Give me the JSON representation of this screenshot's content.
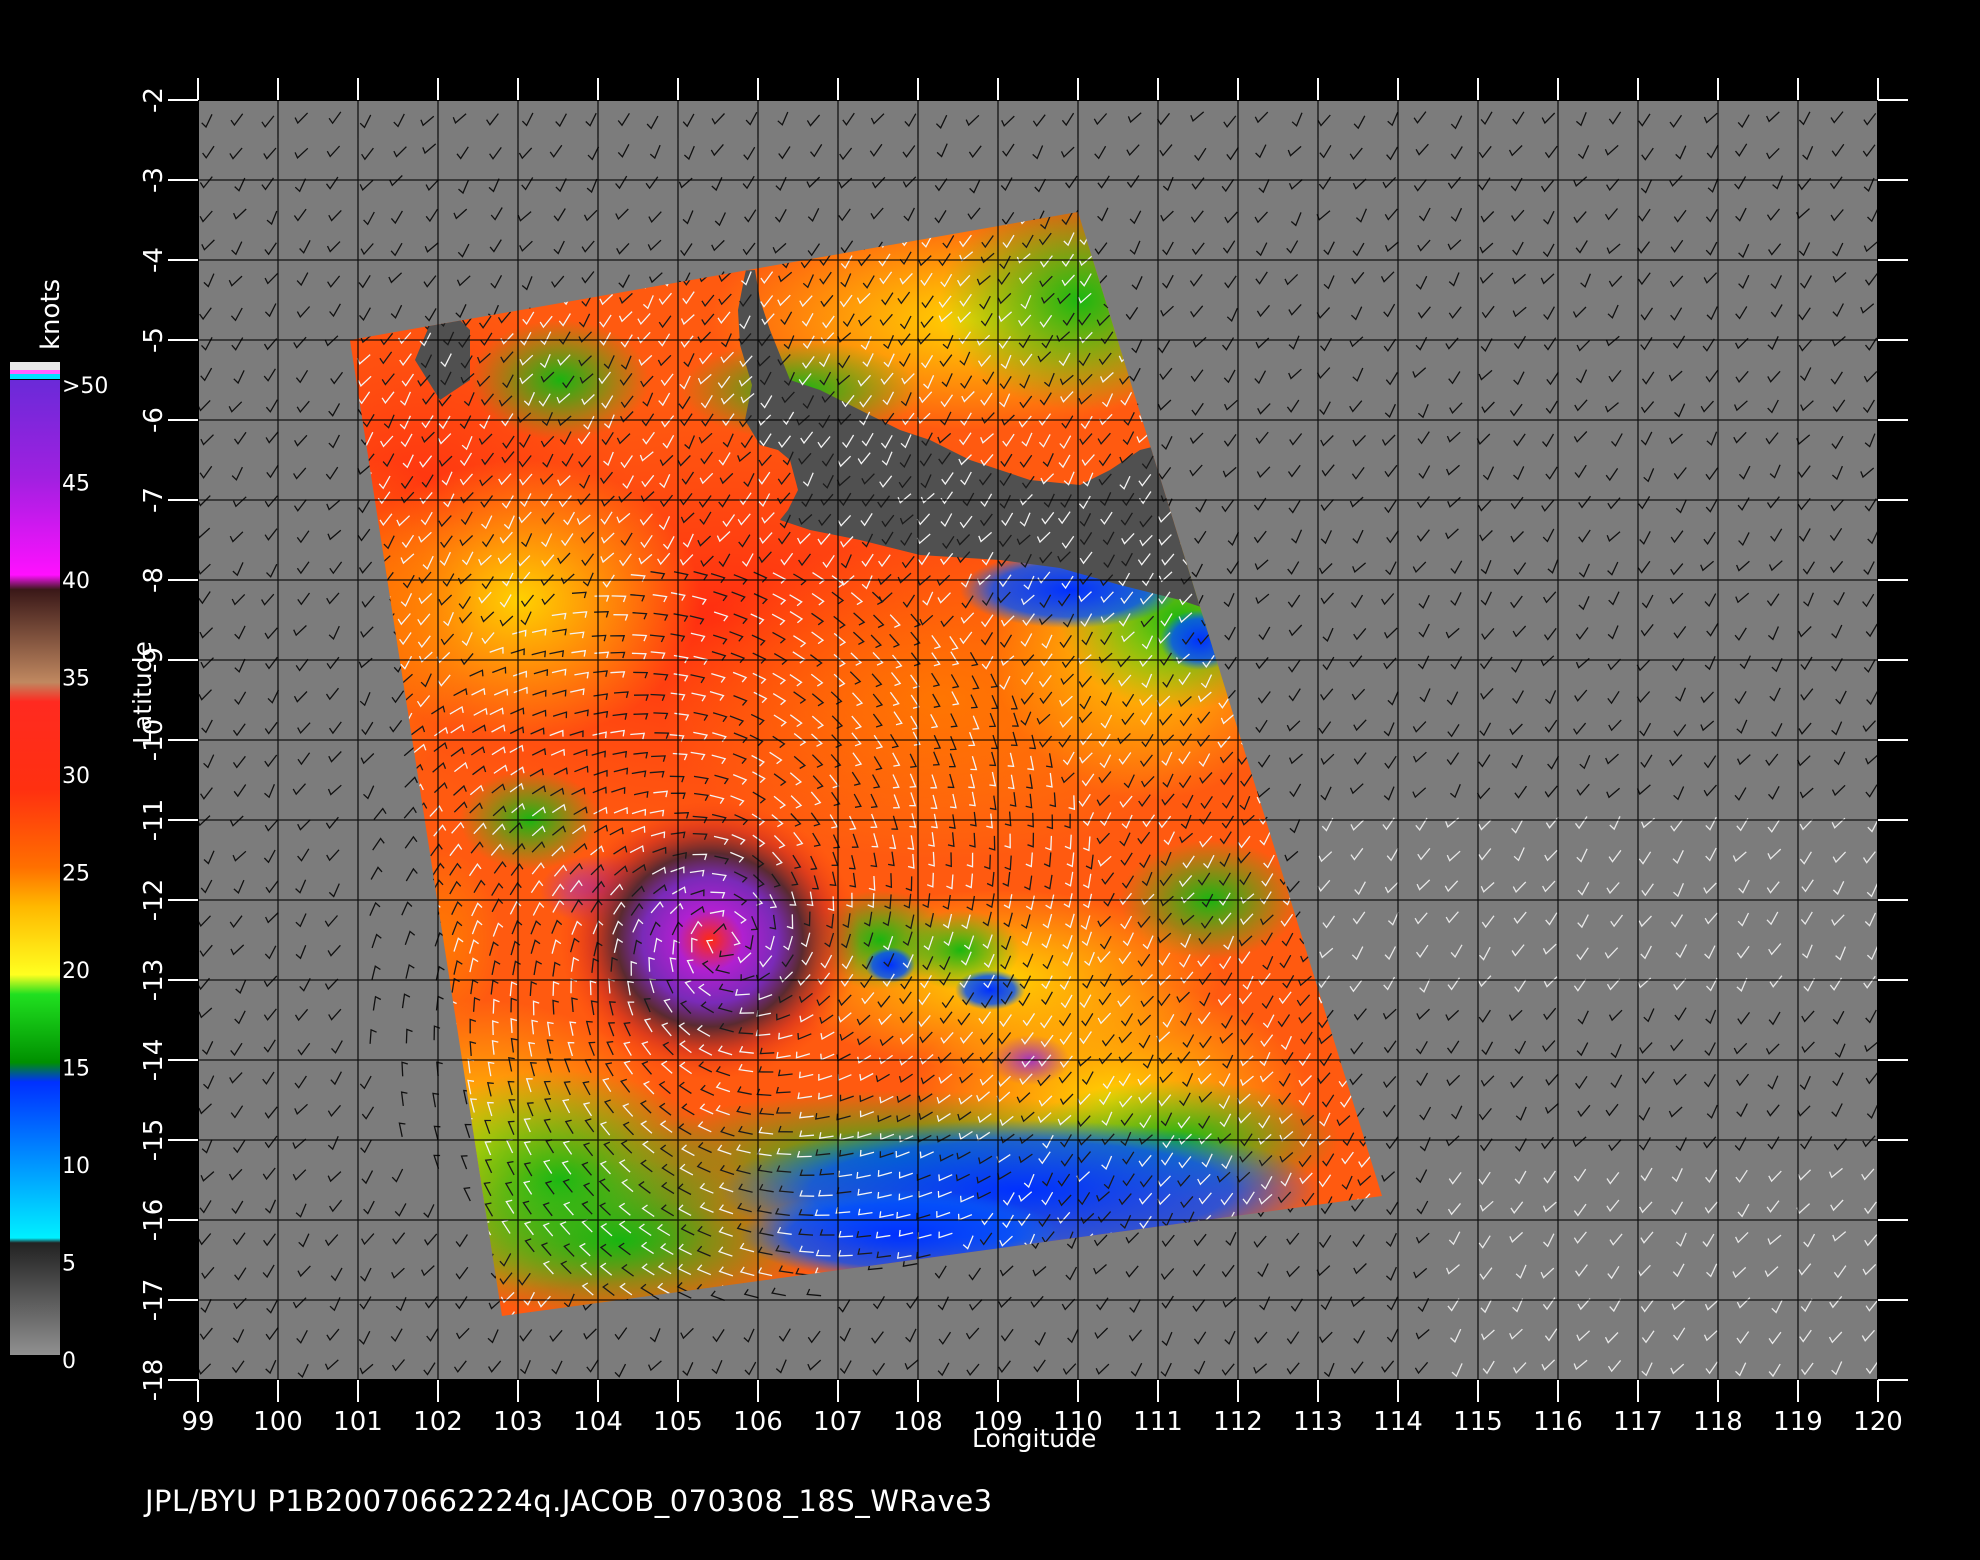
{
  "footer": "JPL/BYU  P1B20070662224q.JACOB_070308_18S_WRave3",
  "map": {
    "xlabel": "Longitude",
    "ylabel": "Latitude",
    "lon_range": [
      99,
      120
    ],
    "lat_range": [
      -18,
      -2
    ],
    "lon_ticks": [
      "99",
      "100",
      "101",
      "102",
      "103",
      "104",
      "105",
      "106",
      "107",
      "108",
      "109",
      "110",
      "111",
      "112",
      "113",
      "114",
      "115",
      "116",
      "117",
      "118",
      "119",
      "120"
    ],
    "lat_ticks": [
      "-2",
      "-3",
      "-4",
      "-5",
      "-6",
      "-7",
      "-8",
      "-9",
      "-10",
      "-11",
      "-12",
      "-13",
      "-14",
      "-15",
      "-16",
      "-17",
      "-18"
    ],
    "swath_corners_lonlat": [
      [
        100.9,
        -5.0
      ],
      [
        110.0,
        -3.4
      ],
      [
        113.8,
        -15.7
      ],
      [
        102.8,
        -17.2
      ]
    ],
    "land_color": "#505050",
    "background_color": "#7c7c7c",
    "storm_center_lonlat": [
      105.6,
      -12.5
    ]
  },
  "colorbar": {
    "title": "knots",
    "labels": [
      ">50",
      "45",
      "40",
      "35",
      "30",
      "25",
      "20",
      "15",
      "10",
      "5",
      "0"
    ],
    "colors": [
      "#7a2ad0",
      "#b020e0",
      "#ff10ff",
      "#402020",
      "#c08060",
      "#ff1a10",
      "#ff6a00",
      "#ffcc00",
      "#00d000",
      "#0050ff",
      "#00e8ff",
      "#444444",
      "#808080"
    ]
  }
}
